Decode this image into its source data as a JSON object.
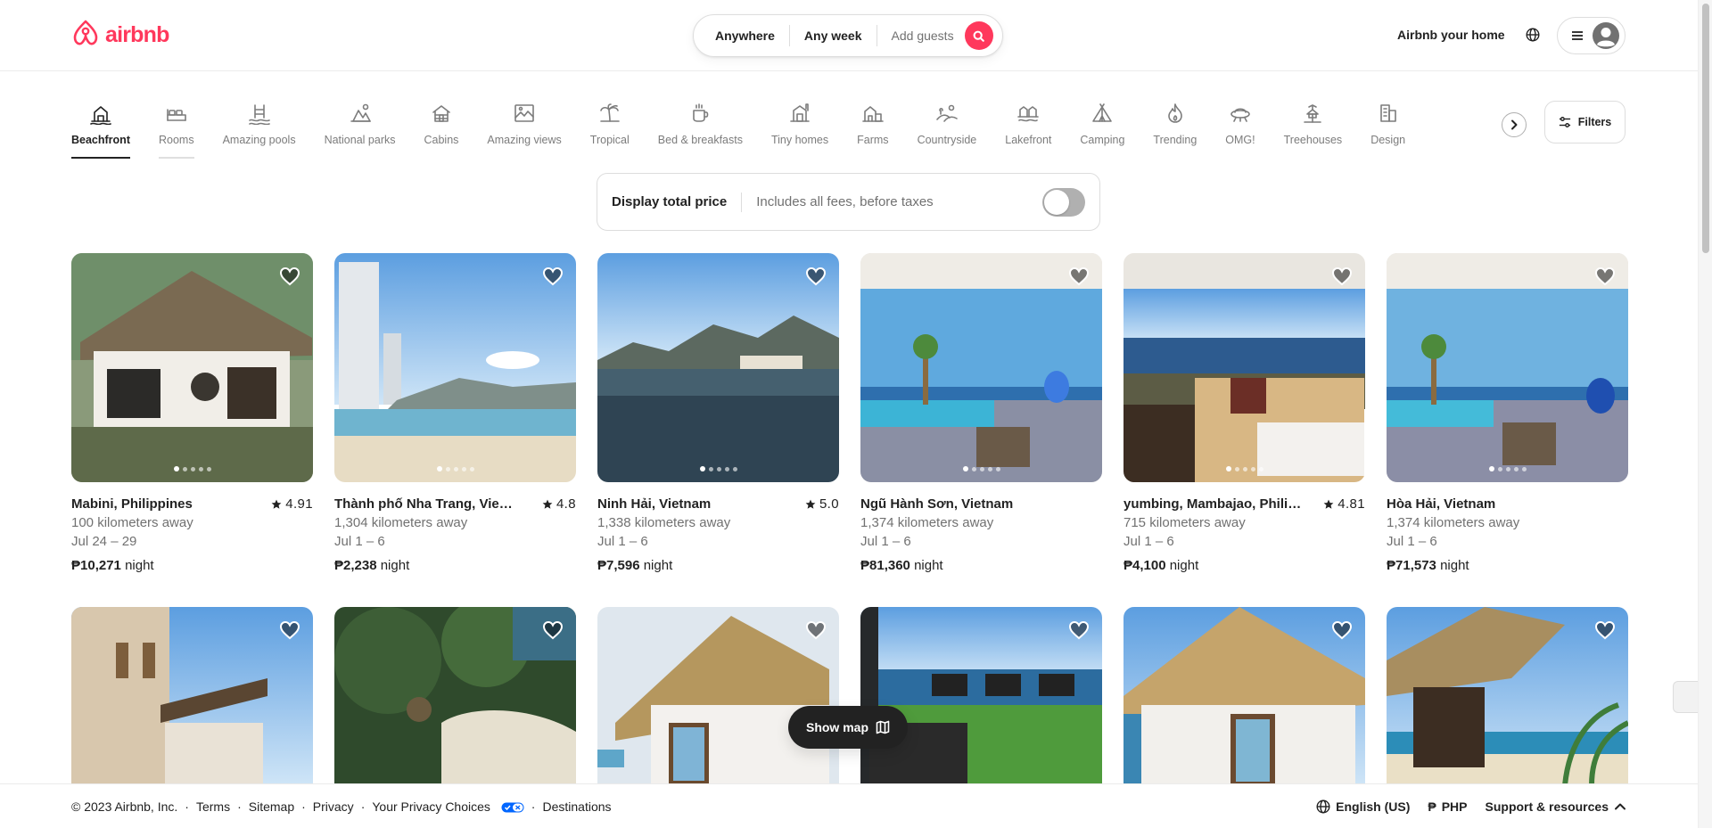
{
  "header": {
    "logo_text": "airbnb",
    "search": {
      "anywhere": "Anywhere",
      "any_week": "Any week",
      "add_guests": "Add guests"
    },
    "host_link": "Airbnb your home"
  },
  "categories": [
    {
      "label": "Beachfront",
      "icon": "beach-house-icon",
      "state": "active"
    },
    {
      "label": "Rooms",
      "icon": "bed-icon",
      "state": "hover"
    },
    {
      "label": "Amazing pools",
      "icon": "pool-icon",
      "state": ""
    },
    {
      "label": "National parks",
      "icon": "park-icon",
      "state": ""
    },
    {
      "label": "Cabins",
      "icon": "cabin-icon",
      "state": ""
    },
    {
      "label": "Amazing views",
      "icon": "view-icon",
      "state": ""
    },
    {
      "label": "Tropical",
      "icon": "palm-icon",
      "state": ""
    },
    {
      "label": "Bed & breakfasts",
      "icon": "coffee-icon",
      "state": ""
    },
    {
      "label": "Tiny homes",
      "icon": "tiny-home-icon",
      "state": ""
    },
    {
      "label": "Farms",
      "icon": "farm-icon",
      "state": ""
    },
    {
      "label": "Countryside",
      "icon": "countryside-icon",
      "state": ""
    },
    {
      "label": "Lakefront",
      "icon": "lakefront-icon",
      "state": ""
    },
    {
      "label": "Camping",
      "icon": "tent-icon",
      "state": ""
    },
    {
      "label": "Trending",
      "icon": "flame-icon",
      "state": ""
    },
    {
      "label": "OMG!",
      "icon": "ufo-icon",
      "state": ""
    },
    {
      "label": "Treehouses",
      "icon": "treehouse-icon",
      "state": ""
    },
    {
      "label": "Design",
      "icon": "design-icon",
      "state": ""
    }
  ],
  "filters_label": "Filters",
  "price_toggle": {
    "title": "Display total price",
    "subtitle": "Includes all fees, before taxes",
    "enabled": false
  },
  "listings": [
    {
      "location": "Mabini, Philippines",
      "rating": "4.91",
      "distance": "100 kilometers away",
      "dates": "Jul 24 – 29",
      "price": "₱10,271",
      "unit": "night"
    },
    {
      "location": "Thành phố Nha Trang, Vietnam",
      "rating": "4.8",
      "distance": "1,304 kilometers away",
      "dates": "Jul 1 – 6",
      "price": "₱2,238",
      "unit": "night"
    },
    {
      "location": "Ninh Hải, Vietnam",
      "rating": "5.0",
      "distance": "1,338 kilometers away",
      "dates": "Jul 1 – 6",
      "price": "₱7,596",
      "unit": "night"
    },
    {
      "location": "Ngũ Hành Sơn, Vietnam",
      "rating": "",
      "distance": "1,374 kilometers away",
      "dates": "Jul 1 – 6",
      "price": "₱81,360",
      "unit": "night"
    },
    {
      "location": "yumbing, Mambajao, Philippi...",
      "rating": "4.81",
      "distance": "715 kilometers away",
      "dates": "Jul 1 – 6",
      "price": "₱4,100",
      "unit": "night"
    },
    {
      "location": "Hòa Hải, Vietnam",
      "rating": "",
      "distance": "1,374 kilometers away",
      "dates": "Jul 1 – 6",
      "price": "₱71,573",
      "unit": "night"
    }
  ],
  "show_map_label": "Show map",
  "footer": {
    "copyright": "© 2023 Airbnb, Inc.",
    "links": [
      "Terms",
      "Sitemap",
      "Privacy",
      "Your Privacy Choices",
      "Destinations"
    ],
    "language": "English (US)",
    "currency_symbol": "₱",
    "currency": "PHP",
    "support": "Support & resources"
  },
  "colors": {
    "brand": "#ff385c",
    "text": "#222222",
    "muted": "#717171",
    "border": "#dddddd"
  }
}
